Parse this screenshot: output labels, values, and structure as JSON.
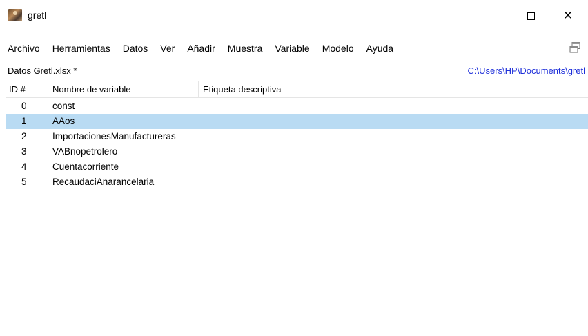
{
  "window": {
    "title": "gretl",
    "controls": {
      "minimize_icon": "minimize-icon",
      "maximize_icon": "maximize-icon",
      "close_icon": "close-icon",
      "close_glyph": "✕"
    }
  },
  "menu": {
    "items": [
      {
        "label": "Archivo"
      },
      {
        "label": "Herramientas"
      },
      {
        "label": "Datos"
      },
      {
        "label": "Ver"
      },
      {
        "label": "Añadir"
      },
      {
        "label": "Muestra"
      },
      {
        "label": "Variable"
      },
      {
        "label": "Modelo"
      },
      {
        "label": "Ayuda"
      }
    ],
    "toolbar_icon": "windows-list-icon"
  },
  "status": {
    "dataset": "Datos Gretl.xlsx *",
    "path": "C:\\Users\\HP\\Documents\\gretl"
  },
  "table": {
    "headers": {
      "id": "ID #",
      "name": "Nombre de variable",
      "label": "Etiqueta descriptiva"
    },
    "rows": [
      {
        "id": "0",
        "name": "const",
        "label": "",
        "selected": false
      },
      {
        "id": "1",
        "name": "AAos",
        "label": "",
        "selected": true
      },
      {
        "id": "2",
        "name": "ImportacionesManufactureras",
        "label": "",
        "selected": false
      },
      {
        "id": "3",
        "name": "VABnopetrolero",
        "label": "",
        "selected": false
      },
      {
        "id": "4",
        "name": "Cuentacorriente",
        "label": "",
        "selected": false
      },
      {
        "id": "5",
        "name": "RecaudaciAnarancelaria",
        "label": "",
        "selected": false
      }
    ]
  },
  "colors": {
    "selection": "#b9dbf3",
    "path_link": "#1e2fd9"
  }
}
